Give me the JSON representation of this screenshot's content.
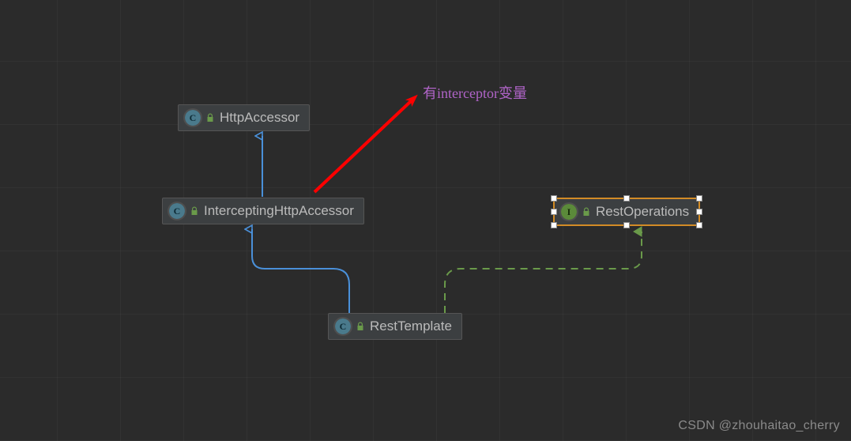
{
  "diagram": {
    "annotation": "有interceptor变量",
    "watermark": "CSDN @zhouhaitao_cherry",
    "nodes": {
      "httpAccessor": {
        "label": "HttpAccessor",
        "kind": "class"
      },
      "interceptingHttpAccessor": {
        "label": "InterceptingHttpAccessor",
        "kind": "class"
      },
      "restTemplate": {
        "label": "RestTemplate",
        "kind": "class"
      },
      "restOperations": {
        "label": "RestOperations",
        "kind": "interface",
        "selected": true
      }
    },
    "edges": [
      {
        "from": "interceptingHttpAccessor",
        "to": "httpAccessor",
        "style": "extends"
      },
      {
        "from": "restTemplate",
        "to": "interceptingHttpAccessor",
        "style": "extends"
      },
      {
        "from": "restTemplate",
        "to": "restOperations",
        "style": "implements"
      }
    ],
    "colors": {
      "extends": "#4a90d9",
      "implements": "#6a9a4a",
      "arrow": "#ff0000",
      "selection": "#d28b26"
    }
  }
}
